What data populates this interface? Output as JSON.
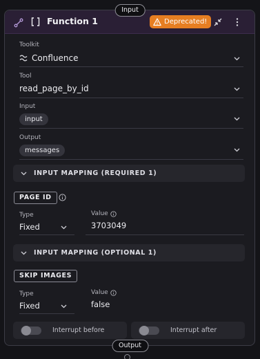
{
  "ports": {
    "input_label": "Input",
    "output_label": "Output"
  },
  "header": {
    "title": "Function 1",
    "badge": "Deprecated!",
    "icons": [
      "connector-icon",
      "function-bracket-icon",
      "warning-icon",
      "collapse-icon",
      "more-vertical-icon"
    ],
    "colors": {
      "header_bg": "#2a1f35",
      "badge_bg": "#e67e22"
    }
  },
  "fields": {
    "toolkit": {
      "label": "Toolkit",
      "value": "Confluence",
      "icon": "confluence-icon"
    },
    "tool": {
      "label": "Tool",
      "value": "read_page_by_id"
    },
    "input": {
      "label": "Input",
      "value": "input"
    },
    "output": {
      "label": "Output",
      "value": "messages"
    }
  },
  "mapping_required": {
    "title": "INPUT MAPPING (REQUIRED 1)",
    "param": "PAGE ID",
    "type_label": "Type",
    "type_value": "Fixed",
    "value_label": "Value",
    "value": "3703049"
  },
  "mapping_optional": {
    "title": "INPUT MAPPING (OPTIONAL 1)",
    "param": "SKIP IMAGES",
    "type_label": "Type",
    "type_value": "Fixed",
    "value_label": "Value",
    "value": "false"
  },
  "interrupts": {
    "before_label": "Interrupt before",
    "before_on": false,
    "after_label": "Interrupt after",
    "after_on": false
  }
}
